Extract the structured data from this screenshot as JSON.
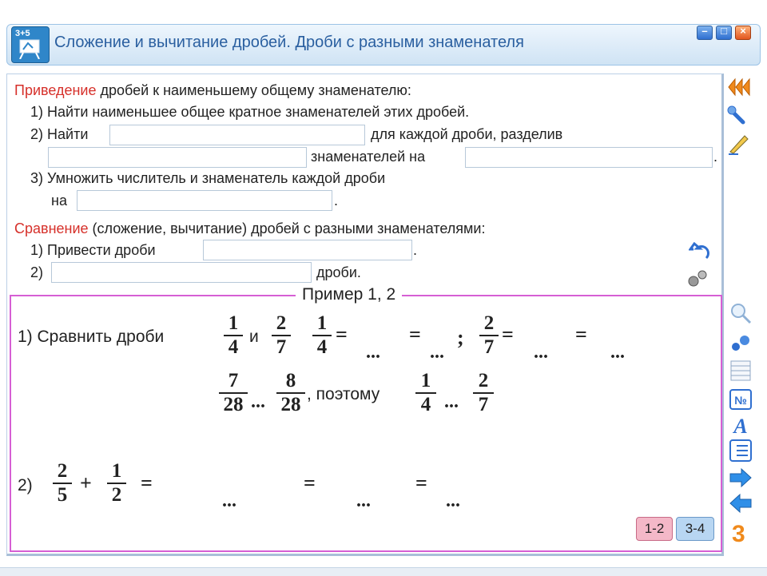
{
  "window": {
    "icon_label": "3+5",
    "title": "Сложение и вычитание дробей. Дроби с разными знаменателя",
    "controls": [
      "–",
      "□",
      "×"
    ]
  },
  "section1": {
    "heading_red": "Приведение",
    "heading_rest": " дробей к наименьшему общему знаменателю:",
    "step1": "1) Найти наименьшее общее кратное знаменателей этих дробей.",
    "step2_a": "2) Найти",
    "step2_b": "для каждой дроби, разделив",
    "step2_c": "знаменателей на",
    "step2_d": ".",
    "step3_a": "3) Умножить числитель и знаменатель каждой дроби",
    "step3_b": "на",
    "step3_c": "."
  },
  "section2": {
    "heading_red": "Сравнение",
    "heading_rest": " (сложение, вычитание) дробей с разными знаменателями:",
    "step1_a": "1) Привести дроби",
    "step1_b": ".",
    "step2_a": "2)",
    "step2_b": "дроби."
  },
  "example": {
    "title": "Пример 1, 2",
    "task1_label": "1) Сравнить дроби",
    "and": "и",
    "eq": "=",
    "dots": "...",
    "semicolon": ";",
    "so": ", поэтому",
    "task2_label": "2)",
    "plus": "+",
    "fractions": {
      "a": {
        "num": "1",
        "den": "4"
      },
      "b": {
        "num": "2",
        "den": "7"
      },
      "c": {
        "num": "1",
        "den": "4"
      },
      "d": {
        "num": "2",
        "den": "7"
      },
      "e": {
        "num": "7",
        "den": "28"
      },
      "f": {
        "num": "8",
        "den": "28"
      },
      "g": {
        "num": "1",
        "den": "4"
      },
      "h": {
        "num": "2",
        "den": "7"
      },
      "i": {
        "num": "2",
        "den": "5"
      },
      "j": {
        "num": "1",
        "den": "2"
      }
    }
  },
  "tabs": {
    "t1": "1-2",
    "t2": "3-4"
  },
  "sidebar_icons": [
    "rewind-icon",
    "wrench-icon",
    "pencil-icon",
    "undo-icon",
    "gears-icon",
    "magnifier-icon",
    "gears-small-icon",
    "table-icon",
    "number-icon",
    "letter-a-icon",
    "list-icon",
    "arrow-right-icon",
    "arrow-left-icon",
    "chapter-3-icon"
  ],
  "colors": {
    "accent": "#2a5fa0",
    "red": "#d6302a",
    "example_border": "#d65fd4"
  },
  "chapter_number": "3"
}
